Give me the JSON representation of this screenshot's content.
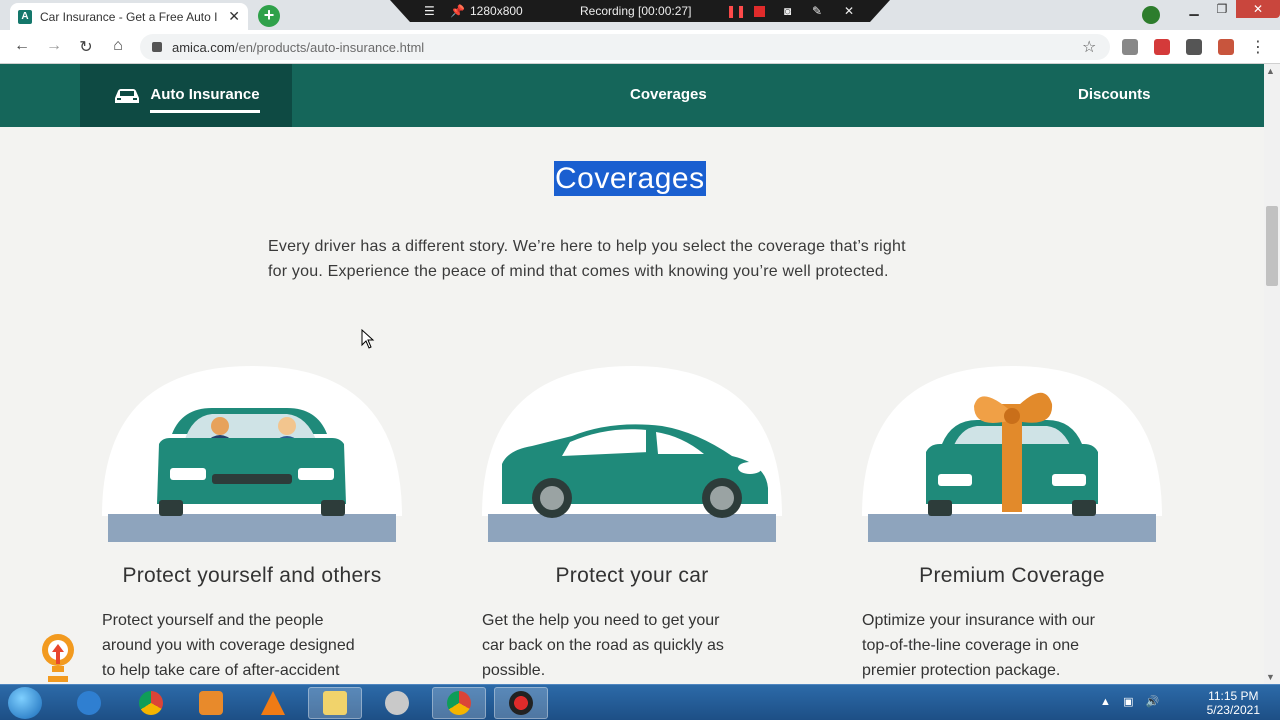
{
  "browser": {
    "tab_title": "Car Insurance - Get a Free Auto I",
    "tab_favicon": "A",
    "new_tab_label": "+",
    "url_host": "amica.com",
    "url_path": "/en/products/auto-insurance.html",
    "recording_size": "1280x800",
    "recording_status": "Recording [00:00:27]"
  },
  "site_nav": {
    "active_label": "Auto Insurance",
    "coverages_label": "Coverages",
    "discounts_label": "Discounts"
  },
  "main": {
    "heading": "Coverages",
    "intro_line1": "Every driver has a different story. We’re here to help you select the coverage that’s right",
    "intro_line2": "for you. Experience the peace of mind that comes with knowing you’re well protected."
  },
  "cards": [
    {
      "title": "Protect yourself and others",
      "text_lines": [
        "Protect yourself and the people",
        "around you with coverage designed",
        "to help take care of after-accident"
      ]
    },
    {
      "title": "Protect your car",
      "text_lines": [
        "Get the help you need to get your",
        "car back on the road as quickly as",
        "possible."
      ]
    },
    {
      "title": "Premium Coverage",
      "text_lines": [
        "Optimize your insurance with our",
        "top-of-the-line coverage in one",
        "premier protection package."
      ]
    }
  ],
  "taskbar": {
    "time": "11:15 PM",
    "date": "5/23/2021"
  },
  "colors": {
    "nav_bg": "#15665a",
    "nav_active_bg": "#0e4a43",
    "car_teal": "#1f8a7a",
    "road": "#8ea4bd",
    "highlight": "#1a5fd0"
  }
}
